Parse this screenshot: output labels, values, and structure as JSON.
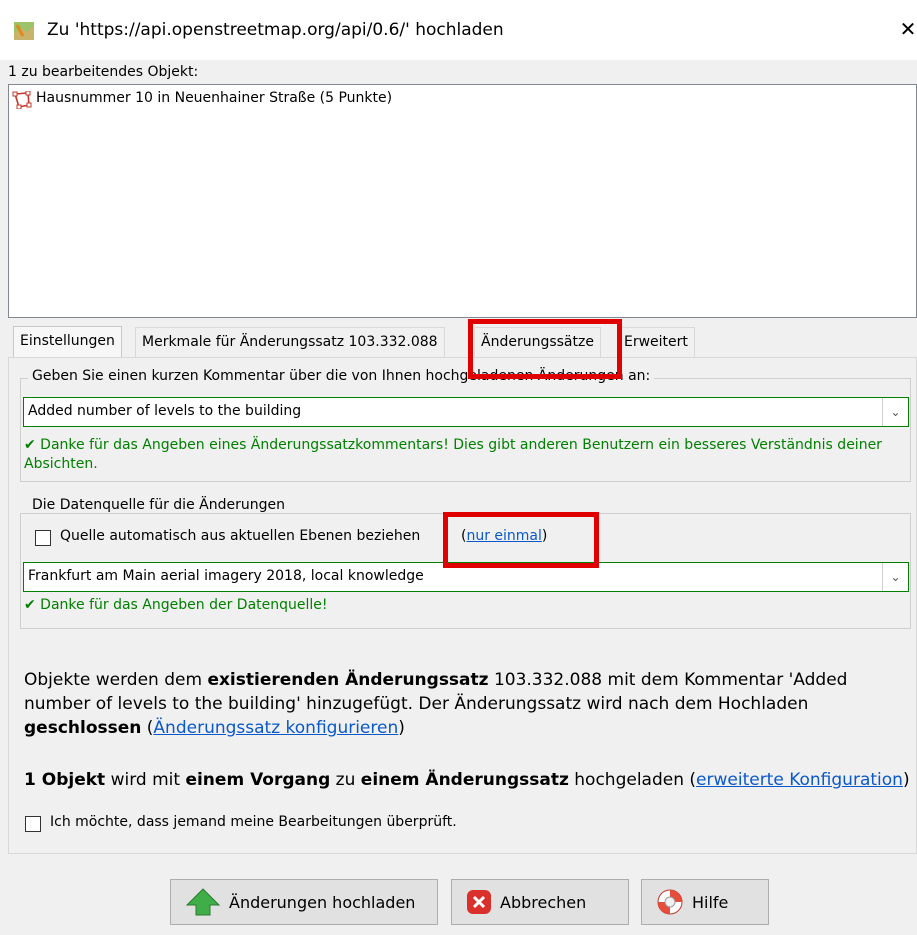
{
  "window": {
    "title": "Zu 'https://api.openstreetmap.org/api/0.6/' hochladen",
    "close_glyph": "✕"
  },
  "objects": {
    "label": "1 zu bearbeitendes Objekt:",
    "items": [
      {
        "icon": "way-polygon-icon",
        "text": "Hausnummer 10 in Neuenhainer Straße (5 Punkte)"
      }
    ]
  },
  "tabs": [
    {
      "label": "Einstellungen",
      "active": true
    },
    {
      "label": "Merkmale für Änderungssatz 103.332.088",
      "active": false
    },
    {
      "label": "Änderungssätze",
      "active": false
    },
    {
      "label": "Erweitert",
      "active": false
    }
  ],
  "comment": {
    "legend": "Geben Sie einen kurzen Kommentar über die von Ihnen hochgeladenen Änderungen an:",
    "value": "Added number of levels to the building",
    "feedback": "✔ Danke für das Angeben eines Änderungssatzkommentars! Dies gibt anderen Benutzern ein besseres Verständnis deiner Absichten."
  },
  "source": {
    "legend": "Die Datenquelle für die Änderungen",
    "auto_checkbox_label": "Quelle automatisch aus aktuellen Ebenen beziehen",
    "once_link": "nur einmal",
    "value": "Frankfurt am Main aerial imagery 2018, local knowledge",
    "feedback": "✔ Danke für das Angeben der Datenquelle!"
  },
  "info": {
    "p1_a": "Objekte werden dem ",
    "p1_b": "existierenden Änderungssatz",
    "p1_c": " 103.332.088 mit dem Kommentar 'Added number of levels to the building' hinzugefügt. Der Änderungssatz wird nach dem Hochladen ",
    "p1_d": "geschlossen",
    "p1_e": " (",
    "p1_link": "Änderungssatz konfigurieren",
    "p1_f": ")",
    "p2_a": "1 Objekt",
    "p2_b": " wird mit ",
    "p2_c": "einem Vorgang",
    "p2_d": " zu ",
    "p2_e": "einem Änderungssatz",
    "p2_f": " hochgeladen (",
    "p2_link": "erweiterte Konfiguration",
    "p2_g": ")",
    "review_label": "Ich möchte, dass jemand meine Bearbeitungen überprüft."
  },
  "buttons": {
    "upload": "Änderungen hochladen",
    "cancel": "Abbrechen",
    "help": "Hilfe"
  },
  "colors": {
    "highlight": "#e00000",
    "ok_green": "#008000",
    "link": "#0a58ca"
  }
}
